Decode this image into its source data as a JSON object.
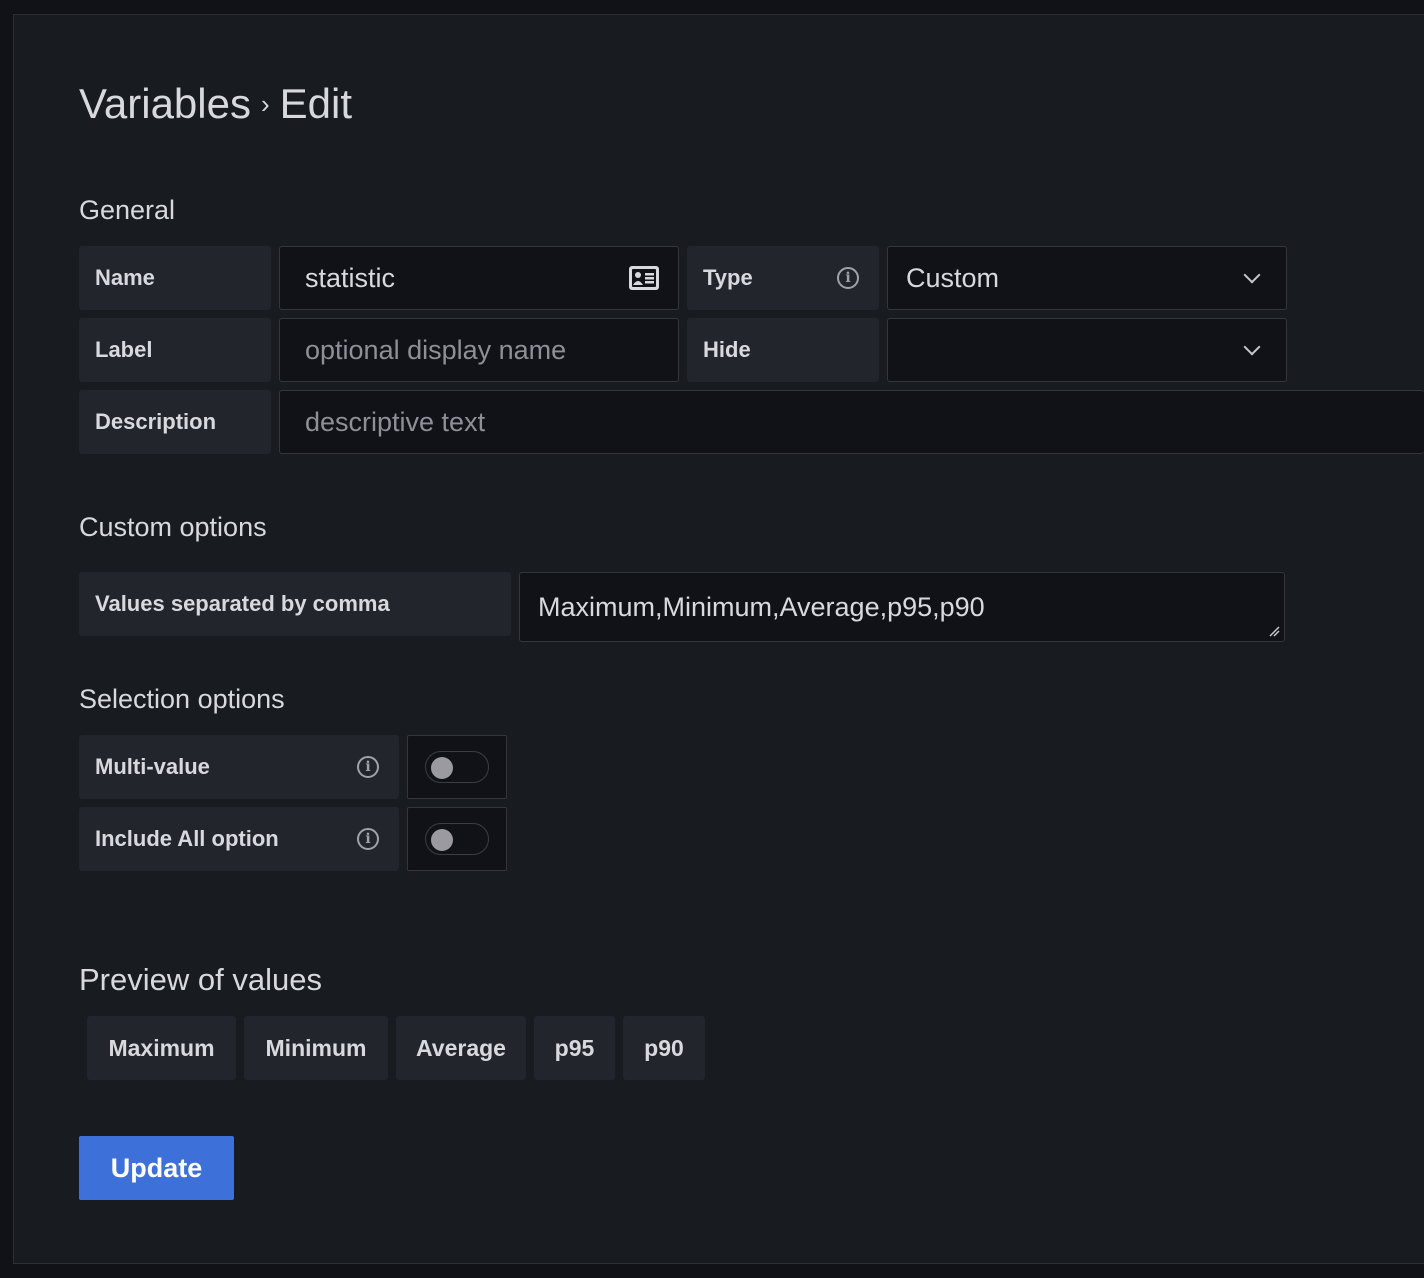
{
  "header": {
    "breadcrumb_parent": "Variables",
    "breadcrumb_separator": "›",
    "breadcrumb_current": "Edit"
  },
  "general": {
    "section_title": "General",
    "name_label": "Name",
    "name_value": "statistic",
    "type_label": "Type",
    "type_value": "Custom",
    "label_label": "Label",
    "label_placeholder": "optional display name",
    "hide_label": "Hide",
    "hide_value": "",
    "description_label": "Description",
    "description_placeholder": "descriptive text"
  },
  "custom_options": {
    "section_title": "Custom options",
    "values_label": "Values separated by comma",
    "values_value": "Maximum,Minimum,Average,p95,p90"
  },
  "selection_options": {
    "section_title": "Selection options",
    "multi_value_label": "Multi-value",
    "multi_value_enabled": false,
    "include_all_label": "Include All option",
    "include_all_enabled": false
  },
  "preview": {
    "section_title": "Preview of values",
    "values": [
      "Maximum",
      "Minimum",
      "Average",
      "p95",
      "p90"
    ]
  },
  "actions": {
    "update_label": "Update"
  },
  "icons": {
    "name_field": "id-card-icon",
    "info": "info-circle-icon",
    "dropdown": "chevron-down-icon",
    "resize": "resize-grip-icon"
  },
  "colors": {
    "page_bg": "#111217",
    "panel_bg": "#181b1f",
    "label_bg": "#22252b",
    "input_bg": "#111217",
    "primary_button": "#3d71d9",
    "text": "#d8d9de",
    "placeholder": "#8e9098"
  }
}
